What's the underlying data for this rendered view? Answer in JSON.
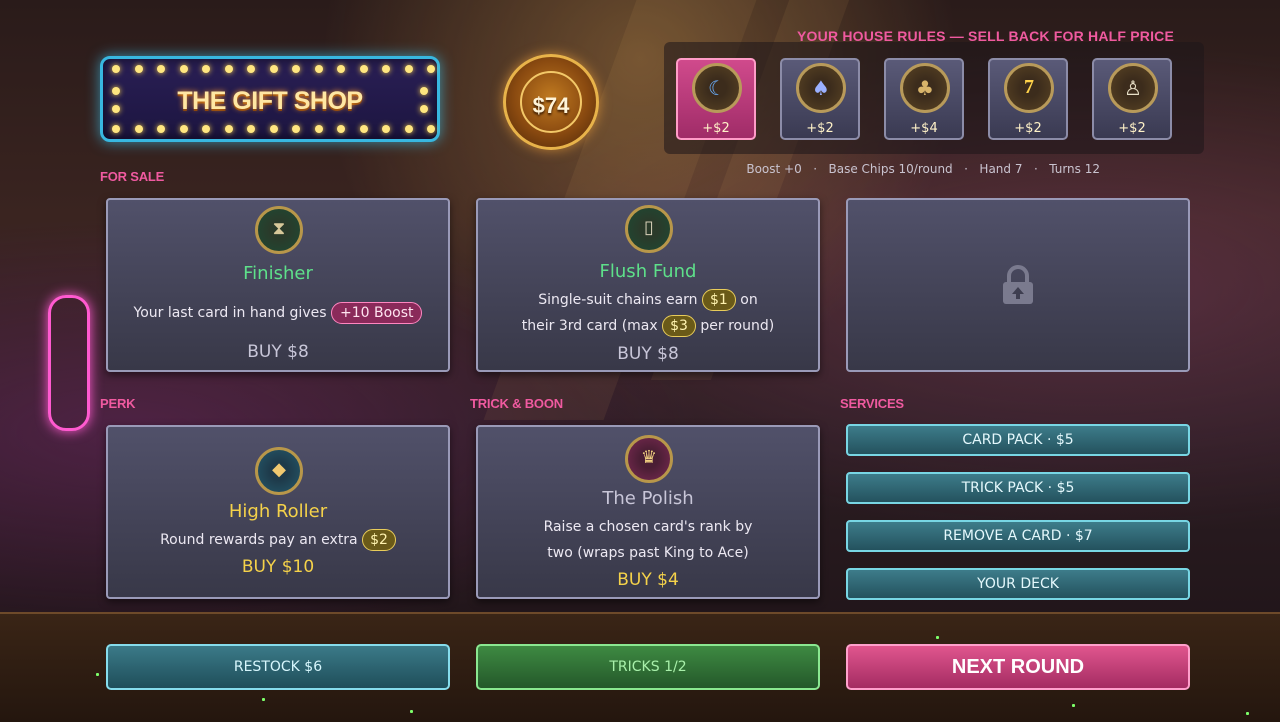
{
  "header": {
    "shop_title": "THE GIFT SHOP",
    "money": "$74"
  },
  "house_rules": {
    "title": "YOUR HOUSE RULES — SELL BACK FOR HALF PRICE",
    "cards": [
      {
        "icon": "moon-chip-icon",
        "price": "+$2",
        "selected": true
      },
      {
        "icon": "spade-chip-icon",
        "price": "+$2",
        "selected": false
      },
      {
        "icon": "club-chip-icon",
        "price": "+$4",
        "selected": false
      },
      {
        "icon": "seven-chip-icon",
        "price": "+$2",
        "selected": false
      },
      {
        "icon": "lamp-chip-icon",
        "price": "+$2",
        "selected": false
      }
    ]
  },
  "stats": {
    "boost": "Boost +0",
    "base_chips": "Base Chips 10/round",
    "hand": "Hand 7",
    "turns": "Turns 12",
    "separator": "·"
  },
  "sections": {
    "for_sale": "FOR SALE",
    "perk": "PERK",
    "trick_boon": "TRICK & BOON",
    "services": "SERVICES"
  },
  "for_sale": [
    {
      "name": "Finisher",
      "title_color": "#5ee08a",
      "icon": "hourglass-chip-icon",
      "desc_before": "Your last card in hand gives",
      "badge": "+10 Boost",
      "price": "BUY  $8"
    },
    {
      "name": "Flush Fund",
      "title_color": "#5ee08a",
      "icon": "card-chip-icon",
      "line1_before": "Single-suit chains earn",
      "line1_badge": "$1",
      "line1_after": "on",
      "line2_before": "their 3rd card (max",
      "line2_badge": "$3",
      "line2_after": "per round)",
      "price": "BUY  $8"
    },
    {
      "locked": true,
      "icon": "lock-icon"
    }
  ],
  "perk": {
    "name": "High Roller",
    "title_color": "#f5d24a",
    "icon": "gem-chip-icon",
    "desc_before": "Round rewards pay an extra",
    "badge": "$2",
    "price": "BUY  $10"
  },
  "trick": {
    "name": "The Polish",
    "title_color": "#c8c6d8",
    "icon": "crown-chip-icon",
    "line1": "Raise a chosen card's rank by",
    "line2": "two (wraps past King to Ace)",
    "price": "BUY  $4"
  },
  "services": [
    {
      "label": "CARD PACK   ·   $5"
    },
    {
      "label": "TRICK PACK   ·   $5"
    },
    {
      "label": "REMOVE A CARD   ·   $7"
    },
    {
      "label": "YOUR DECK"
    }
  ],
  "footer": {
    "restock": "RESTOCK  $6",
    "tricks": "TRICKS  1/2",
    "next_round": "NEXT ROUND"
  }
}
